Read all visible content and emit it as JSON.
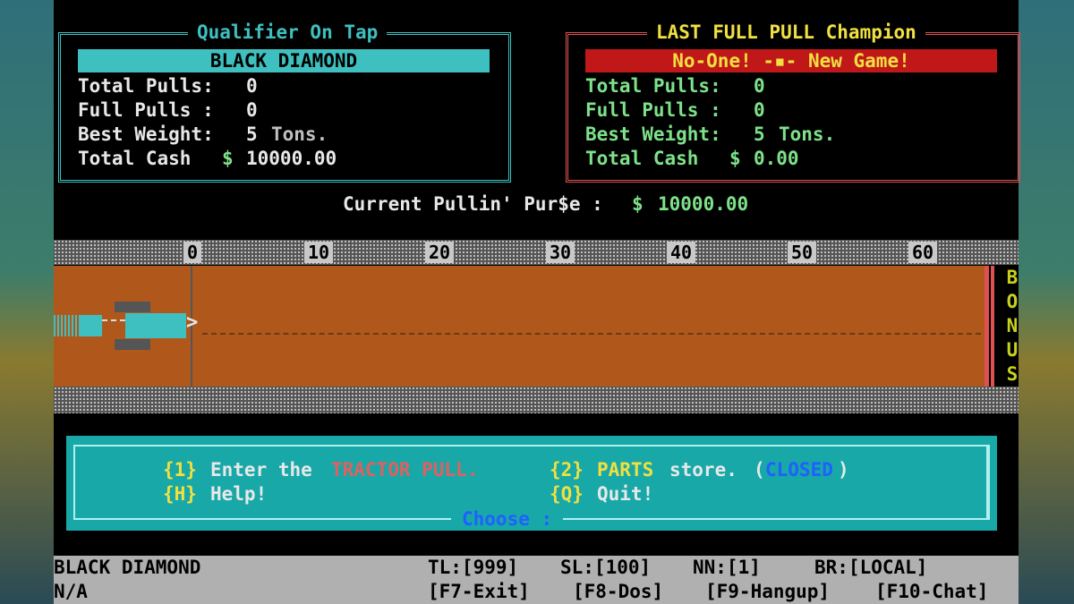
{
  "qualifier": {
    "title": "Qualifier On Tap",
    "name": "BLACK DIAMOND",
    "total_pulls_label": "Total Pulls:",
    "total_pulls": "0",
    "full_pulls_label": "Full Pulls :",
    "full_pulls": "0",
    "best_weight_label": "Best Weight:",
    "best_weight_num": "5",
    "best_weight_unit": "Tons.",
    "total_cash_label": "Total Cash",
    "cash_symbol": "$",
    "total_cash": "10000.00"
  },
  "champion": {
    "title": "LAST FULL PULL Champion",
    "banner": "No-One! -▪- New Game!",
    "total_pulls_label": "Total Pulls:",
    "total_pulls": "0",
    "full_pulls_label": "Full Pulls :",
    "full_pulls": "0",
    "best_weight_label": "Best Weight:",
    "best_weight_num": "5",
    "best_weight_unit": "Tons.",
    "total_cash_label": "Total Cash",
    "cash_symbol": "$",
    "total_cash": "0.00"
  },
  "purse": {
    "label": "Current Pullin' Pur$e :",
    "symbol": "$",
    "value": "10000.00"
  },
  "track": {
    "ticks": [
      "0",
      "10",
      "20",
      "30",
      "40",
      "50",
      "60"
    ],
    "bonus_letters": [
      "B",
      "O",
      "N",
      "U",
      "S"
    ]
  },
  "menu": {
    "opt1_key": "{1}",
    "opt1_text": "Enter the",
    "opt1_hi": "TRACTOR PULL.",
    "opt2_key": "{2}",
    "opt2_hi": "PARTS",
    "opt2_text": "store.",
    "opt2_paren_open": "(",
    "opt2_status": "CLOSED",
    "opt2_paren_close": ")",
    "help_key": "{H}",
    "help_text": "Help!",
    "quit_key": "{Q}",
    "quit_text": "Quit!",
    "prompt": "Choose :"
  },
  "status_bar": {
    "user": "BLACK DIAMOND",
    "info": "N/A",
    "tl": "TL:[999]",
    "sl": "SL:[100]",
    "nn": "NN:[1]",
    "br": "BR:[LOCAL]",
    "f7": "[F7-Exit]",
    "f8": "[F8-Dos]",
    "f9": "[F9-Hangup]",
    "f10": "[F10-Chat]"
  },
  "colors": {
    "cyan": "#3fc0c0",
    "red": "#e05050",
    "dirt": "#b0581c",
    "menu_bg": "#18a8a8"
  }
}
